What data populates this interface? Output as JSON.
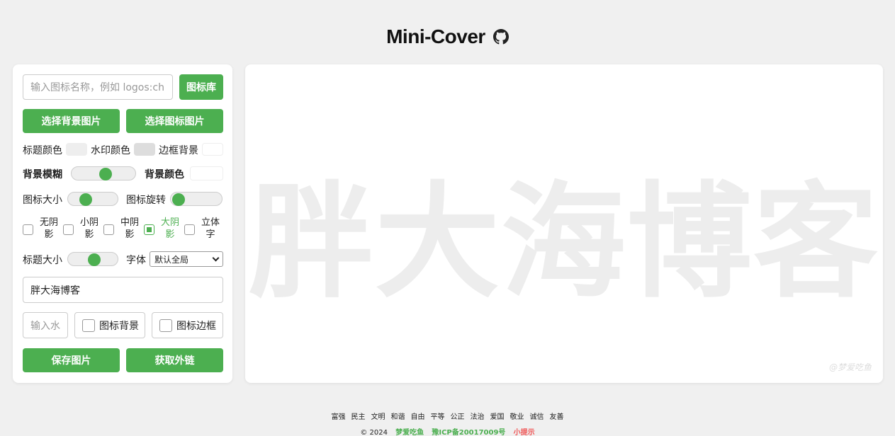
{
  "app": {
    "title": "Mini-Cover"
  },
  "icon_input": {
    "placeholder": "输入图标名称，例如 logos:chrome"
  },
  "buttons": {
    "icon_library": "图标库",
    "select_bg_image": "选择背景图片",
    "select_icon_image": "选择图标图片",
    "save_image": "保存图片",
    "get_link": "获取外链"
  },
  "colors": {
    "title_color_label": "标题颜色",
    "watermark_color_label": "水印颜色",
    "border_bg_label": "边框背景",
    "bg_color_label": "背景颜色",
    "accent": "#4caf50",
    "title_swatch": "#eeeeee",
    "watermark_swatch": "#dddddd",
    "border_swatch": "#ffffff",
    "bg_swatch": "#ffffff"
  },
  "sliders": {
    "bg_blur_label": "背景模糊",
    "bg_blur_value": 0.55,
    "icon_size_label": "图标大小",
    "icon_size_value": 0.3,
    "icon_rotate_label": "图标旋转",
    "icon_rotate_value": 0.0,
    "title_size_label": "标题大小",
    "title_size_value": 0.55
  },
  "shadows": [
    {
      "line1": "无阴",
      "line2": "影",
      "checked": false
    },
    {
      "line1": "小阴",
      "line2": "影",
      "checked": false
    },
    {
      "line1": "中阴",
      "line2": "影",
      "checked": false
    },
    {
      "line1": "大阴",
      "line2": "影",
      "checked": true
    },
    {
      "line1": "立体",
      "line2": "字",
      "checked": false
    }
  ],
  "font": {
    "label": "字体",
    "selected": "默认全局"
  },
  "title_input": {
    "value": "胖大海博客"
  },
  "watermark_input": {
    "placeholder": "输入水印"
  },
  "options": {
    "icon_bg": "图标背景",
    "icon_border": "图标边框"
  },
  "preview": {
    "title_text": "胖大海博客",
    "watermark": "@梦爱吃鱼"
  },
  "footer": {
    "values": [
      "富强",
      "民主",
      "文明",
      "和谐",
      "自由",
      "平等",
      "公正",
      "法治",
      "爱国",
      "敬业",
      "诚信",
      "友善"
    ],
    "copyright": "© 2024",
    "author": "梦爱吃鱼",
    "icp": "豫ICP备20017009号",
    "tip": "小提示"
  }
}
